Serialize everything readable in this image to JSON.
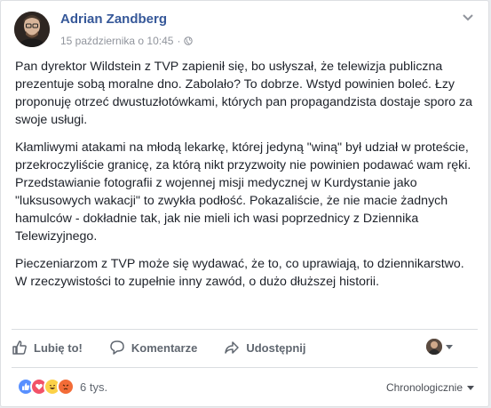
{
  "post": {
    "author": "Adrian Zandberg",
    "date": "15 października o 10:45",
    "separator": "·",
    "paragraphs": [
      "Pan dyrektor Wildstein z TVP zapienił się, bo usłyszał, że telewizja publiczna prezentuje sobą moralne dno. Zabolało? To dobrze. Wstyd powinien boleć. Łzy proponuję otrzeć dwustuzłotówkami, których pan propagandzista dostaje sporo za swoje usługi.",
      "Kłamliwymi atakami na młodą lekarkę, której jedyną \"winą\" był udział w proteście, przekroczyliście granicę, za którą nikt przyzwoity nie powinien podawać wam ręki. Przedstawianie fotografii z wojennej misji medycznej w Kurdystanie jako \"luksusowych wakacji\" to zwykła podłość. Pokazaliście, że nie macie żadnych hamulców - dokładnie tak, jak nie mieli ich wasi poprzednicy z Dziennika Telewizyjnego.",
      "Pieczeniarzom z TVP może się wydawać, że to, co uprawiają, to dziennikarstwo. W rzeczywistości to zupełnie inny zawód, o dużo dłuższej historii."
    ]
  },
  "actions": {
    "like": "Lubię to!",
    "comment": "Komentarze",
    "share": "Udostępnij"
  },
  "reactions": {
    "count": "6 tys.",
    "types": [
      "like-icon",
      "love-icon",
      "haha-icon",
      "angry-icon"
    ]
  },
  "sort": {
    "label": "Chronologicznie"
  },
  "colors": {
    "author": "#365899",
    "meta": "#90949c",
    "action": "#606770",
    "like": "#5890ff",
    "love": "#f25268",
    "haha": "#fcd147",
    "angry": "#f36c37"
  }
}
